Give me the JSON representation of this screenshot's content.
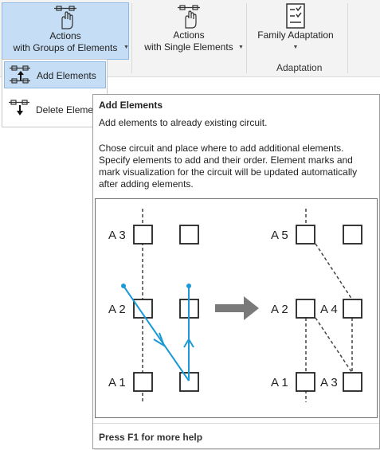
{
  "ribbon": {
    "groups_button": {
      "line1": "Actions",
      "line2": "with Groups of Elements",
      "icon": "hand-elements-icon"
    },
    "single_button": {
      "line1": "Actions",
      "line2": "with Single Elements",
      "icon": "hand-element-icon"
    },
    "family_button": {
      "label": "Family Adaptation",
      "icon": "checklist-icon"
    },
    "group_label": "Adaptation"
  },
  "dropdown": {
    "items": [
      {
        "label": "Add Elements",
        "icon": "add-elements-icon",
        "selected": true
      },
      {
        "label": "Delete Elemen",
        "icon": "delete-elements-icon",
        "selected": false
      }
    ]
  },
  "tooltip": {
    "title": "Add Elements",
    "subtitle": "Add elements to already existing circuit.",
    "description": "Chose circuit and place where to add additional elements. Specify elements to add and their order. Element marks and mark visualization for the circuit will be updated automatically after adding elements.",
    "footer": "Press F1 for more help",
    "diagram": {
      "left_labels": [
        "A 3",
        "A 2",
        "A 1"
      ],
      "right_labels": [
        "A 5",
        "A 2",
        "A 4",
        "A 1",
        "A 3"
      ],
      "accent_color": "#1b9ad6",
      "arrow_color": "#7a7a7a"
    }
  },
  "colors": {
    "selected_bg": "#c5def5",
    "selected_border": "#8fb9e1",
    "ribbon_bg": "#f3f3f3"
  }
}
